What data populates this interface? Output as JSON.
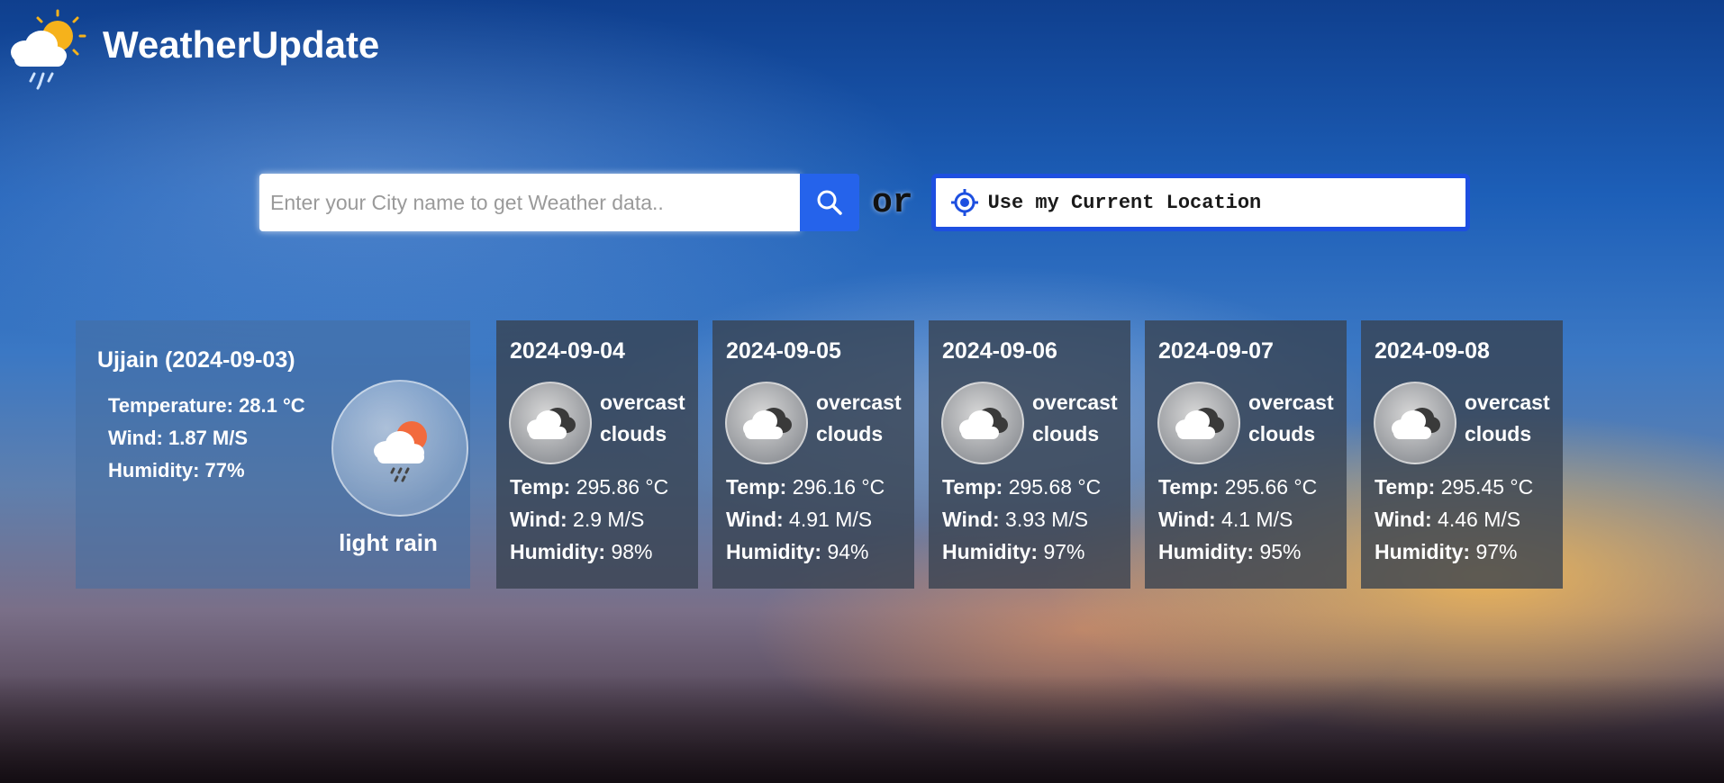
{
  "app": {
    "title": "WeatherUpdate"
  },
  "search": {
    "placeholder": "Enter your City name to get Weather data..",
    "or_text": "or",
    "location_button_label": "Use my Current Location"
  },
  "current": {
    "title": "Ujjain (2024-09-03)",
    "temperature": "Temperature: 28.1 °C",
    "wind": "Wind: 1.87 M/S",
    "humidity": "Humidity: 77%",
    "description": "light rain",
    "icon": "light-rain-icon"
  },
  "labels": {
    "temp": "Temp:",
    "wind": "Wind:",
    "humidity": "Humidity:"
  },
  "forecast": [
    {
      "date": "2024-09-04",
      "desc_line1": "overcast",
      "desc_line2": "clouds",
      "temp": "295.86 °C",
      "wind": "2.9 M/S",
      "humidity": "98%",
      "icon": "overcast-clouds-icon"
    },
    {
      "date": "2024-09-05",
      "desc_line1": "overcast",
      "desc_line2": "clouds",
      "temp": "296.16 °C",
      "wind": "4.91 M/S",
      "humidity": "94%",
      "icon": "overcast-clouds-icon"
    },
    {
      "date": "2024-09-06",
      "desc_line1": "overcast",
      "desc_line2": "clouds",
      "temp": "295.68 °C",
      "wind": "3.93 M/S",
      "humidity": "97%",
      "icon": "overcast-clouds-icon"
    },
    {
      "date": "2024-09-07",
      "desc_line1": "overcast",
      "desc_line2": "clouds",
      "temp": "295.66 °C",
      "wind": "4.1 M/S",
      "humidity": "95%",
      "icon": "overcast-clouds-icon"
    },
    {
      "date": "2024-09-08",
      "desc_line1": "overcast",
      "desc_line2": "clouds",
      "temp": "295.45 °C",
      "wind": "4.46 M/S",
      "humidity": "97%",
      "icon": "overcast-clouds-icon"
    }
  ],
  "colors": {
    "accent": "#2563eb",
    "location_border": "#1d4fe0"
  }
}
